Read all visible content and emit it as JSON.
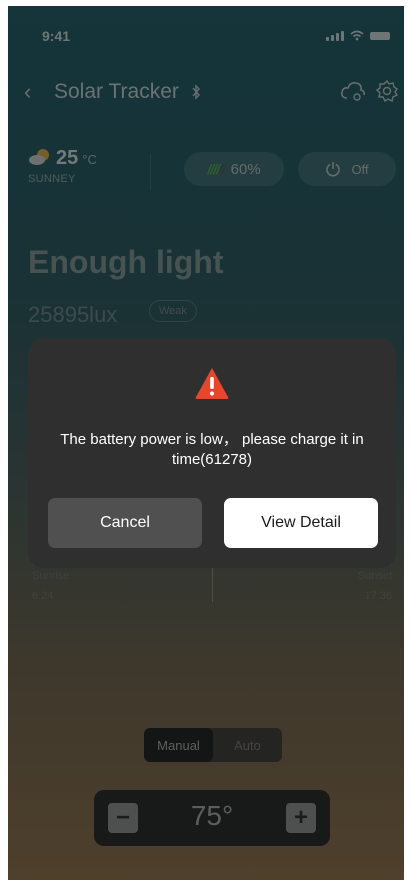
{
  "status_bar": {
    "time": "9:41"
  },
  "header": {
    "title": "Solar Tracker"
  },
  "weather": {
    "temperature": "25",
    "unit": "°C",
    "condition": "SUNNEY"
  },
  "battery": {
    "bars": "////",
    "bars_empty": "//",
    "percent": "60%",
    "level": 0.6,
    "color": "#4fa04a"
  },
  "power": {
    "label": "Off"
  },
  "light": {
    "status": "Enough light",
    "lux": "25895lux",
    "strength": "Weak"
  },
  "sun": {
    "sunrise_label": "Sunrise",
    "sunrise_time": "6:24",
    "sunset_label": "Sunset",
    "sunset_time": "17:36"
  },
  "mode": {
    "manual_label": "Manual",
    "auto_label": "Auto",
    "selected": "Manual"
  },
  "angle": {
    "value": "75°",
    "minus_label": "−",
    "plus_label": "+"
  },
  "dialog": {
    "message": "The battery power is low， please charge it in time(61278)",
    "cancel_label": "Cancel",
    "detail_label": "View Detail",
    "warning_color": "#e5462c"
  }
}
